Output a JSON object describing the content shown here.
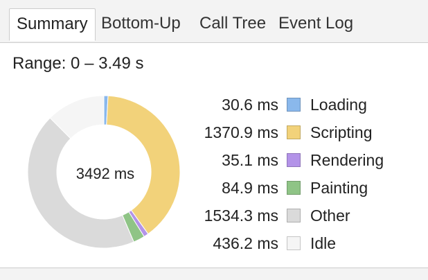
{
  "tabs": [
    {
      "label": "Summary",
      "active": true
    },
    {
      "label": "Bottom-Up",
      "active": false
    },
    {
      "label": "Call Tree",
      "active": false
    },
    {
      "label": "Event Log",
      "active": false
    }
  ],
  "range_text": "Range: 0 – 3.49 s",
  "chart_data": {
    "type": "pie",
    "donut": true,
    "center_label": "3492 ms",
    "total_ms": 3492,
    "categories": [
      "Loading",
      "Scripting",
      "Rendering",
      "Painting",
      "Other",
      "Idle"
    ],
    "values": [
      30.6,
      1370.9,
      35.1,
      84.9,
      1534.3,
      436.2
    ],
    "value_labels": [
      "30.6 ms",
      "1370.9 ms",
      "35.1 ms",
      "84.9 ms",
      "1534.3 ms",
      "436.2 ms"
    ],
    "colors": [
      "#8ab8ec",
      "#f2d27a",
      "#b393e8",
      "#8fc486",
      "#dadada",
      "#f5f5f5"
    ]
  }
}
